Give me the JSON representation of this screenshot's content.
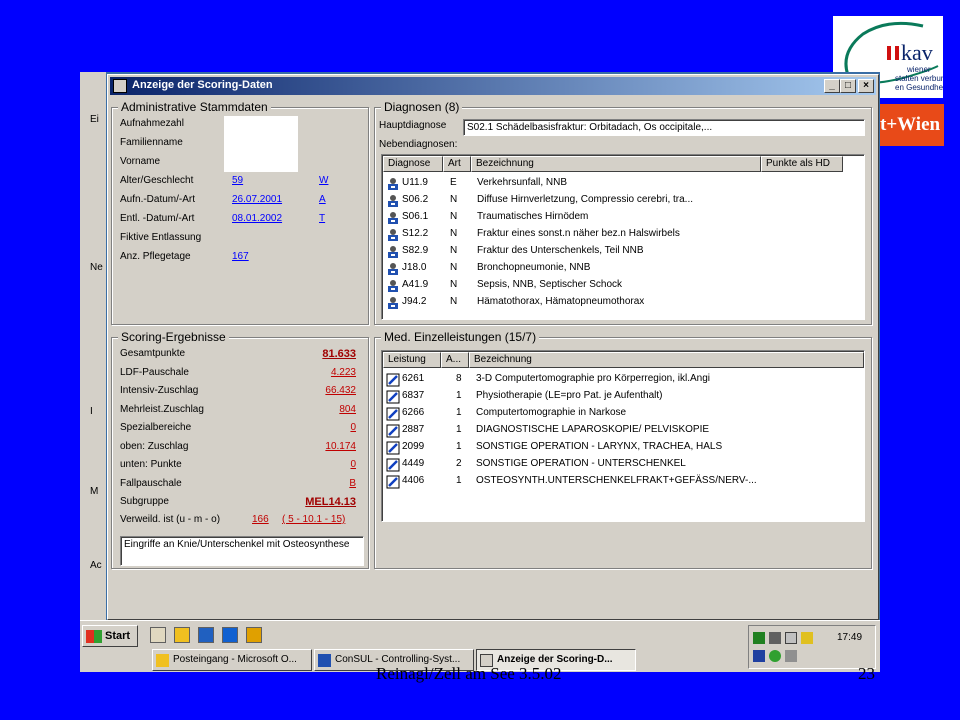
{
  "footer": {
    "left": "Reinagl/Zell am See 3.5.02",
    "right": "23"
  },
  "logos": {
    "kav_mark": "kav",
    "kav_line1": "wiener",
    "kav_line2": "stalten verbund",
    "kav_line3": "en Gesundheit",
    "wien": "t+Wien"
  },
  "background_window": {
    "letters": [
      "Ei",
      "Ne",
      "I",
      "M",
      "Ac"
    ]
  },
  "dialog": {
    "title": "Anzeige der Scoring-Daten",
    "buttons": {
      "minimize": "_",
      "maximize": "□",
      "close": "×"
    },
    "admin": {
      "title": "Administrative Stammdaten",
      "fields": [
        {
          "label": "Aufnahmezahl",
          "value": "",
          "value2": ""
        },
        {
          "label": "Familienname",
          "value": "",
          "value2": ""
        },
        {
          "label": "Vorname",
          "value": "",
          "value2": ""
        },
        {
          "label": "Alter/Geschlecht",
          "value": "59",
          "value2": "W"
        },
        {
          "label": "Aufn.-Datum/-Art",
          "value": "26.07.2001",
          "value2": "A"
        },
        {
          "label": "Entl. -Datum/-Art",
          "value": "08.01.2002",
          "value2": "T"
        },
        {
          "label": "Fiktive Entlassung",
          "value": "",
          "value2": ""
        },
        {
          "label": "Anz. Pflegetage",
          "value": "167",
          "value2": ""
        }
      ]
    },
    "diagnosen": {
      "title": "Diagnosen  (8)",
      "hauptdiagnose_label": "Hauptdiagnose",
      "hauptdiagnose_value": "S02.1  Schädelbasisfraktur: Orbitadach, Os occipitale,...",
      "nebendiagnosen_label": "Nebendiagnosen:",
      "columns": [
        "Diagnose",
        "Art",
        "Bezeichnung",
        "Punkte als HD"
      ],
      "rows": [
        {
          "code": "U11.9",
          "art": "E",
          "bez": "Verkehrsunfall, NNB"
        },
        {
          "code": "S06.2",
          "art": "N",
          "bez": "Diffuse Hirnverletzung, Compressio cerebri, tra..."
        },
        {
          "code": "S06.1",
          "art": "N",
          "bez": "Traumatisches Hirnödem"
        },
        {
          "code": "S12.2",
          "art": "N",
          "bez": "Fraktur eines sonst.n näher bez.n Halswirbels"
        },
        {
          "code": "S82.9",
          "art": "N",
          "bez": "Fraktur des Unterschenkels, Teil NNB"
        },
        {
          "code": "J18.0",
          "art": "N",
          "bez": "Bronchopneumonie, NNB"
        },
        {
          "code": "A41.9",
          "art": "N",
          "bez": "Sepsis, NNB, Septischer Schock"
        },
        {
          "code": "J94.2",
          "art": "N",
          "bez": "Hämatothorax, Hämatopneumothorax"
        }
      ]
    },
    "scoring": {
      "title": "Scoring-Ergebnisse",
      "rows": [
        {
          "label": "Gesamtpunkte",
          "value": "81.633"
        },
        {
          "label": "LDF-Pauschale",
          "value": "4.223"
        },
        {
          "label": "Intensiv-Zuschlag",
          "value": "66.432"
        },
        {
          "label": "Mehrleist.Zuschlag",
          "value": "804"
        },
        {
          "label": "Spezialbereiche",
          "value": "0"
        },
        {
          "label": "oben: Zuschlag",
          "value": "10.174"
        },
        {
          "label": "unten: Punkte",
          "value": "0"
        },
        {
          "label": "Fallpauschale",
          "value": "B"
        },
        {
          "label": "Subgruppe",
          "value": "MEL14.13"
        }
      ],
      "verweild_label": "Verweild.  ist (u - m - o)",
      "verweild_ist": "166",
      "verweild_range": "( 5 - 10.1 - 15)",
      "description": "Eingriffe an Knie/Unterschenkel mit Osteosynthese"
    },
    "einzelleistungen": {
      "title": "Med. Einzelleistungen  (15/7)",
      "columns": [
        "Leistung",
        "A...",
        "Bezeichnung"
      ],
      "rows": [
        {
          "code": "6261",
          "a": "8",
          "bez": "3-D Computertomographie pro Körperregion, ikl.Angi"
        },
        {
          "code": "6837",
          "a": "1",
          "bez": "Physiotherapie (LE=pro Pat. je Aufenthalt)"
        },
        {
          "code": "6266",
          "a": "1",
          "bez": "Computertomographie in Narkose"
        },
        {
          "code": "2887",
          "a": "1",
          "bez": "DIAGNOSTISCHE LAPAROSKOPIE/ PELVISKOPIE"
        },
        {
          "code": "2099",
          "a": "1",
          "bez": "SONSTIGE OPERATION - LARYNX, TRACHEA, HALS"
        },
        {
          "code": "4449",
          "a": "2",
          "bez": "SONSTIGE OPERATION - UNTERSCHENKEL"
        },
        {
          "code": "4406",
          "a": "1",
          "bez": "OSTEOSYNTH.UNTERSCHENKELFRAKT+GEFÄSS/NERV-..."
        }
      ]
    }
  },
  "taskbar": {
    "start": "Start",
    "quicklaunch": [
      "desktop-icon",
      "calendar-icon",
      "refresh-icon",
      "ie-icon",
      "media-icon"
    ],
    "tasks": [
      {
        "label": "Posteingang - Microsoft O...",
        "active": false
      },
      {
        "label": "ConSUL - Controlling-Syst...",
        "active": false
      },
      {
        "label": "Anzeige der Scoring-D...",
        "active": true
      }
    ],
    "clock": "17:49"
  }
}
